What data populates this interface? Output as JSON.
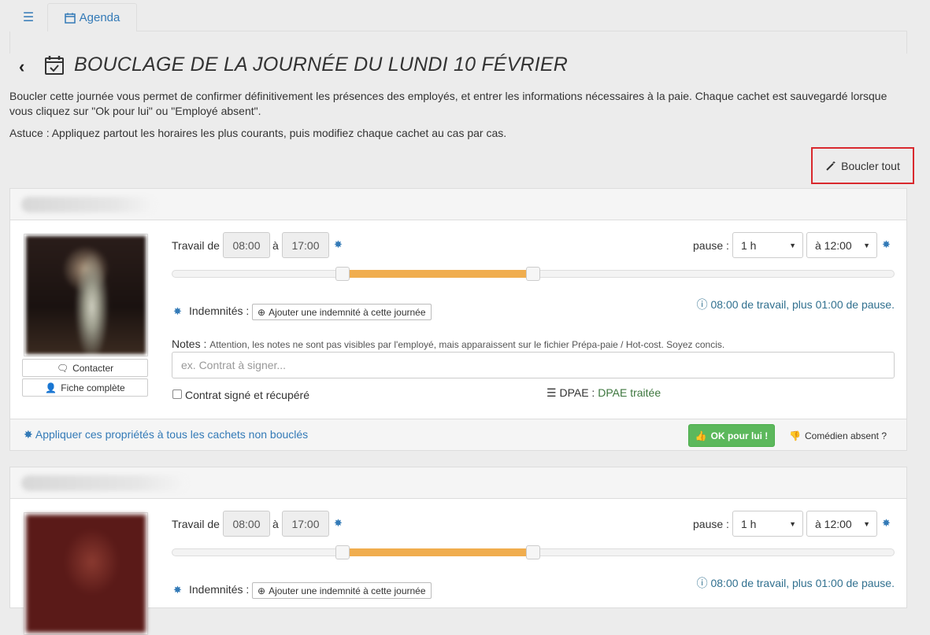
{
  "tabs": {
    "menu_icon": "menu-icon",
    "agenda_label": "Agenda"
  },
  "header": {
    "title": "BOUCLAGE DE LA JOURNÉE DU LUNDI 10 FÉVRIER"
  },
  "intro": {
    "description": "Boucler cette journée vous permet de confirmer définitivement les présences des employés, et entrer les informations nécessaires à la paie. Chaque cachet est sauvegardé lorsque vous cliquez sur \"Ok pour lui\" ou \"Employé absent\".",
    "tip": "Astuce : Appliquez partout les horaires les plus courants, puis modifiez chaque cachet au cas par cas."
  },
  "toolbar": {
    "boucler_tout": "Boucler tout"
  },
  "cards": [
    {
      "contact": "Contacter",
      "full_profile": "Fiche complète",
      "work_label": "Travail de",
      "start_time": "08:00",
      "to_label": "à",
      "end_time": "17:00",
      "pause_label": "pause :",
      "pause_duration": "1 h",
      "pause_at": "à 12:00",
      "slider_range": [
        0.236,
        0.5
      ],
      "indemnites_label": "Indemnités :",
      "add_indemnite": "Ajouter une indemnité à cette journée",
      "summary": "08:00 de travail, plus 01:00 de pause.",
      "notes_label": "Notes :",
      "notes_help": "Attention, les notes ne sont pas visibles par l'employé, mais apparaissent sur le fichier Prépa-paie / Hot-cost. Soyez concis.",
      "notes_placeholder": "ex. Contrat à signer...",
      "contract_label": "Contrat signé et récupéré",
      "contract_checked": false,
      "dpae_label": "DPAE :",
      "dpae_status": "DPAE traitée",
      "apply_all": "Appliquer ces propriétés à tous les cachets non bouclés",
      "ok_label": "OK pour lui !",
      "absent_label": "Comédien absent ?"
    },
    {
      "work_label": "Travail de",
      "start_time": "08:00",
      "to_label": "à",
      "end_time": "17:00",
      "pause_label": "pause :",
      "pause_duration": "1 h",
      "pause_at": "à 12:00",
      "slider_range": [
        0.236,
        0.5
      ],
      "indemnites_label": "Indemnités :",
      "add_indemnite": "Ajouter une indemnité à cette journée",
      "summary": "08:00 de travail, plus 01:00 de pause."
    }
  ],
  "colors": {
    "accent": "#337ab7",
    "slider_fill": "#f0ad4e",
    "ok_button": "#5cb85c",
    "highlight_border": "#d9292e",
    "dpae_status": "#3c763d"
  }
}
